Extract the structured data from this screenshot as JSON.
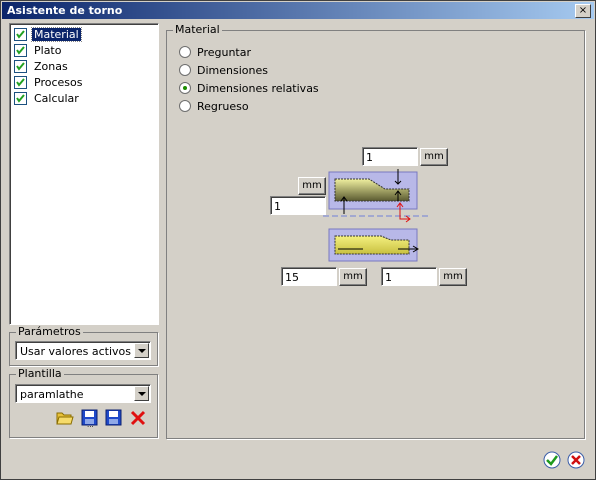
{
  "window": {
    "title": "Asistente de torno",
    "close_label": "×"
  },
  "tree": {
    "items": [
      {
        "label": "Material",
        "checked": true,
        "selected": true
      },
      {
        "label": "Plato",
        "checked": true
      },
      {
        "label": "Zonas",
        "checked": true
      },
      {
        "label": "Procesos",
        "checked": true
      },
      {
        "label": "Calcular",
        "checked": true
      }
    ]
  },
  "parametros": {
    "legend": "Parámetros",
    "value": "Usar valores activos"
  },
  "plantilla": {
    "legend": "Plantilla",
    "value": "paramlathe",
    "icons": [
      "open-folder-icon",
      "save-as-icon",
      "save-icon",
      "delete-icon"
    ]
  },
  "material": {
    "legend": "Material",
    "options": [
      {
        "label": "Preguntar",
        "selected": false
      },
      {
        "label": "Dimensiones",
        "selected": false
      },
      {
        "label": "Dimensiones relativas",
        "selected": true
      },
      {
        "label": "Regrueso",
        "selected": false
      }
    ],
    "top_value": "1",
    "top_unit": "mm",
    "left_value": "1",
    "left_unit": "mm",
    "bottom_left_value": "15",
    "bottom_left_unit": "mm",
    "bottom_right_value": "1",
    "bottom_right_unit": "mm"
  },
  "footer": {
    "ok_icon": "ok-check-icon",
    "cancel_icon": "cancel-x-icon"
  }
}
